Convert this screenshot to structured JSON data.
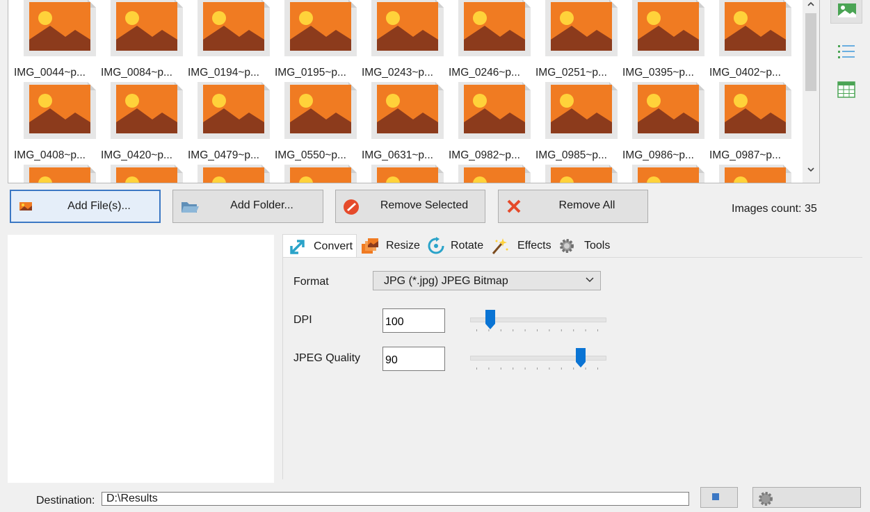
{
  "files": [
    {
      "name": "IMG_0044~p..."
    },
    {
      "name": "IMG_0084~p..."
    },
    {
      "name": "IMG_0194~p..."
    },
    {
      "name": "IMG_0195~p..."
    },
    {
      "name": "IMG_0243~p..."
    },
    {
      "name": "IMG_0246~p..."
    },
    {
      "name": "IMG_0251~p..."
    },
    {
      "name": "IMG_0395~p..."
    },
    {
      "name": "IMG_0402~p..."
    },
    {
      "name": "IMG_0408~p..."
    },
    {
      "name": "IMG_0420~p..."
    },
    {
      "name": "IMG_0479~p..."
    },
    {
      "name": "IMG_0550~p..."
    },
    {
      "name": "IMG_0631~p..."
    },
    {
      "name": "IMG_0982~p..."
    },
    {
      "name": "IMG_0985~p..."
    },
    {
      "name": "IMG_0986~p..."
    },
    {
      "name": "IMG_0987~p..."
    },
    {
      "name": ""
    },
    {
      "name": ""
    },
    {
      "name": ""
    },
    {
      "name": ""
    },
    {
      "name": ""
    },
    {
      "name": ""
    },
    {
      "name": ""
    },
    {
      "name": ""
    },
    {
      "name": ""
    }
  ],
  "icons": {
    "file_thumb": "image-file-icon",
    "scroll_up": "chevron-up-icon",
    "scroll_down": "chevron-down-icon",
    "view_thumbnails": "thumbnail-view-icon",
    "view_list": "list-view-icon",
    "view_table": "table-view-icon"
  },
  "actions": {
    "add_files": "Add File(s)...",
    "add_folder": "Add Folder...",
    "remove_selected": "Remove Selected",
    "remove_all": "Remove All"
  },
  "images_count": "Images count: 35",
  "tabs": [
    {
      "label": "Convert",
      "icon": "convert-icon",
      "active": true
    },
    {
      "label": "Resize",
      "icon": "resize-icon",
      "active": false
    },
    {
      "label": "Rotate",
      "icon": "rotate-icon",
      "active": false
    },
    {
      "label": "Effects",
      "icon": "effects-wand-icon",
      "active": false
    },
    {
      "label": "Tools",
      "icon": "tools-gear-icon",
      "active": false
    }
  ],
  "convert": {
    "format_label": "Format",
    "format_value": "JPG (*.jpg) JPEG Bitmap",
    "dpi_label": "DPI",
    "dpi_value": "100",
    "dpi_slider_fraction": 0.12,
    "quality_label": "JPEG Quality",
    "quality_value": "90",
    "quality_slider_fraction": 0.86
  },
  "destination": {
    "label": "Destination:",
    "value": "D:\\Results"
  },
  "colors": {
    "accent": "#3c78c4",
    "thumb_orange": "#f07b22",
    "slider_knob": "#0a74d4",
    "remove_red": "#e54a2a"
  }
}
